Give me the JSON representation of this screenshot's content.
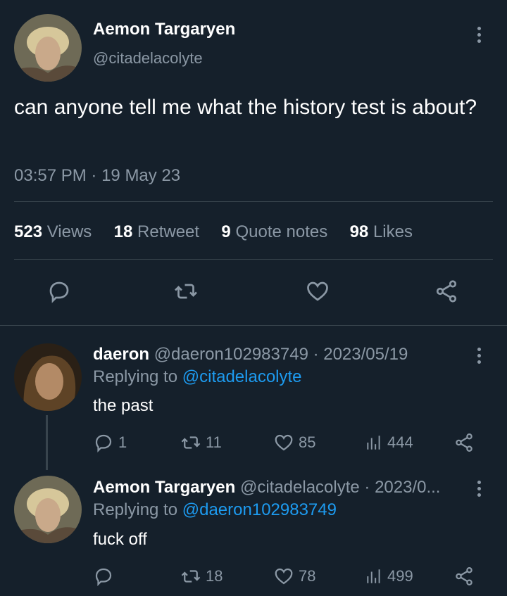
{
  "main_tweet": {
    "author_name": "Aemon Targaryen",
    "author_handle": "@citadelacolyte",
    "text": "can anyone tell me what the history test is about?",
    "time": "03:57 PM",
    "separator": "·",
    "date": "19 May 23",
    "stats": {
      "views_count": "523",
      "views_label": "Views",
      "retweet_count": "18",
      "retweet_label": "Retweet",
      "quote_count": "9",
      "quote_label": "Quote notes",
      "likes_count": "98",
      "likes_label": "Likes"
    },
    "actions": [
      "reply-icon",
      "retweet-icon",
      "like-icon",
      "share-icon"
    ]
  },
  "replies": [
    {
      "author_name": "daeron",
      "meta": "@daeron102983749 · 2023/05/19",
      "replying_prefix": "Replying to",
      "replying_handle": "@citadelacolyte",
      "text": "the past",
      "reply_count": "1",
      "retweet_count": "11",
      "like_count": "85",
      "view_count": "444"
    },
    {
      "author_name": "Aemon Targaryen",
      "meta": "@citadelacolyte · 2023/0...",
      "replying_prefix": "Replying to",
      "replying_handle": "@daeron102983749",
      "text": "fuck off",
      "reply_count": "",
      "retweet_count": "18",
      "like_count": "78",
      "view_count": "499"
    }
  ],
  "colors": {
    "background": "#15202b",
    "text": "#ffffff",
    "muted": "#8b98a5",
    "link": "#1d9bf0",
    "divider": "#38444d"
  }
}
